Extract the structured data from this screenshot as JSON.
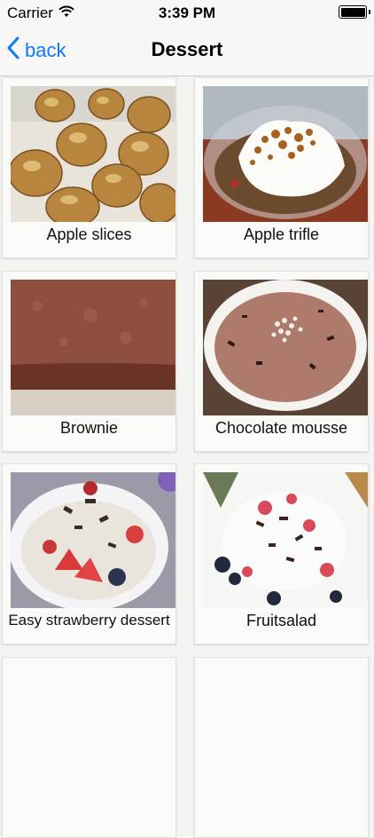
{
  "status_bar": {
    "carrier": "Carrier",
    "time": "3:39 PM"
  },
  "nav": {
    "back_label": "back",
    "title": "Dessert"
  },
  "recipes": [
    {
      "name": "Apple slices"
    },
    {
      "name": "Apple trifle"
    },
    {
      "name": "Brownie"
    },
    {
      "name": "Chocolate mousse"
    },
    {
      "name": "Easy strawberry dessert"
    },
    {
      "name": "Fruitsalad"
    }
  ],
  "colors": {
    "accent": "#0a7aff",
    "background": "#f4f4f2",
    "card": "#fafaf8"
  }
}
